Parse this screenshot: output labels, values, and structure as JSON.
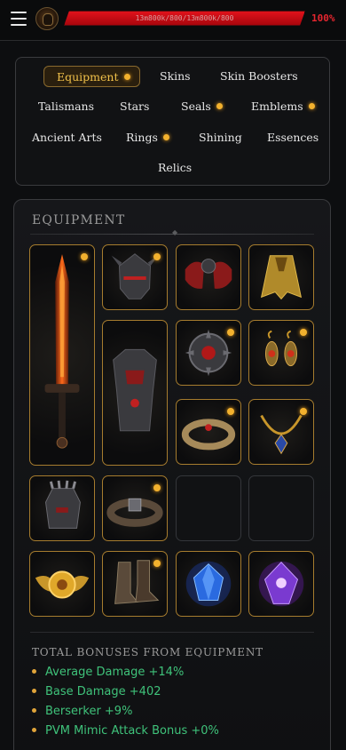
{
  "header": {
    "hp_text": "13m800k/800/13m800k/800",
    "hp_percent": "100%",
    "hp_fraction": 1.0
  },
  "categories": [
    {
      "label": "Equipment",
      "active": true,
      "dot": true
    },
    {
      "label": "Skins",
      "active": false,
      "dot": false
    },
    {
      "label": "Skin Boosters",
      "active": false,
      "dot": false
    },
    {
      "label": "Talismans",
      "active": false,
      "dot": false
    },
    {
      "label": "Stars",
      "active": false,
      "dot": false
    },
    {
      "label": "Seals",
      "active": false,
      "dot": true
    },
    {
      "label": "Emblems",
      "active": false,
      "dot": true
    },
    {
      "label": "Ancient Arts",
      "active": false,
      "dot": false
    },
    {
      "label": "Rings",
      "active": false,
      "dot": true
    },
    {
      "label": "Shining",
      "active": false,
      "dot": false
    },
    {
      "label": "Essences",
      "active": false,
      "dot": false
    },
    {
      "label": "Relics",
      "active": false,
      "dot": false
    }
  ],
  "equipment": {
    "title": "EQUIPMENT",
    "slots": [
      {
        "icon": "sword-icon",
        "filled": true,
        "dot": true
      },
      {
        "icon": "helmet-icon",
        "filled": true,
        "dot": true
      },
      {
        "icon": "shoulder-armor-icon",
        "filled": true,
        "dot": false
      },
      {
        "icon": "cloak-icon",
        "filled": true,
        "dot": false
      },
      {
        "icon": "chest-armor-icon",
        "filled": true,
        "dot": false
      },
      {
        "icon": "shield-amulet-icon",
        "filled": true,
        "dot": true
      },
      {
        "icon": "earrings-icon",
        "filled": true,
        "dot": true
      },
      {
        "icon": "bracelet-icon",
        "filled": true,
        "dot": true
      },
      {
        "icon": "necklace-icon",
        "filled": true,
        "dot": true
      },
      {
        "icon": "gauntlet-icon",
        "filled": true,
        "dot": false
      },
      {
        "icon": "belt-icon",
        "filled": true,
        "dot": true
      },
      {
        "icon": "empty-slot",
        "filled": false,
        "dot": false
      },
      {
        "icon": "empty-slot",
        "filled": false,
        "dot": false
      },
      {
        "icon": "golden-emblem-icon",
        "filled": true,
        "dot": false
      },
      {
        "icon": "boots-icon",
        "filled": true,
        "dot": true
      },
      {
        "icon": "blue-gem-icon",
        "filled": true,
        "dot": false
      },
      {
        "icon": "purple-gem-icon",
        "filled": true,
        "dot": false
      }
    ]
  },
  "bonuses": {
    "title": "TOTAL BONUSES FROM EQUIPMENT",
    "items": [
      "Average Damage +14%",
      "Base Damage +402",
      "Berserker +9%",
      "PVM Mimic Attack Bonus +0%"
    ]
  },
  "colors": {
    "accent_gold": "#f2b12e",
    "hp_red": "#e0121b",
    "bonus_green": "#3fc27a"
  }
}
